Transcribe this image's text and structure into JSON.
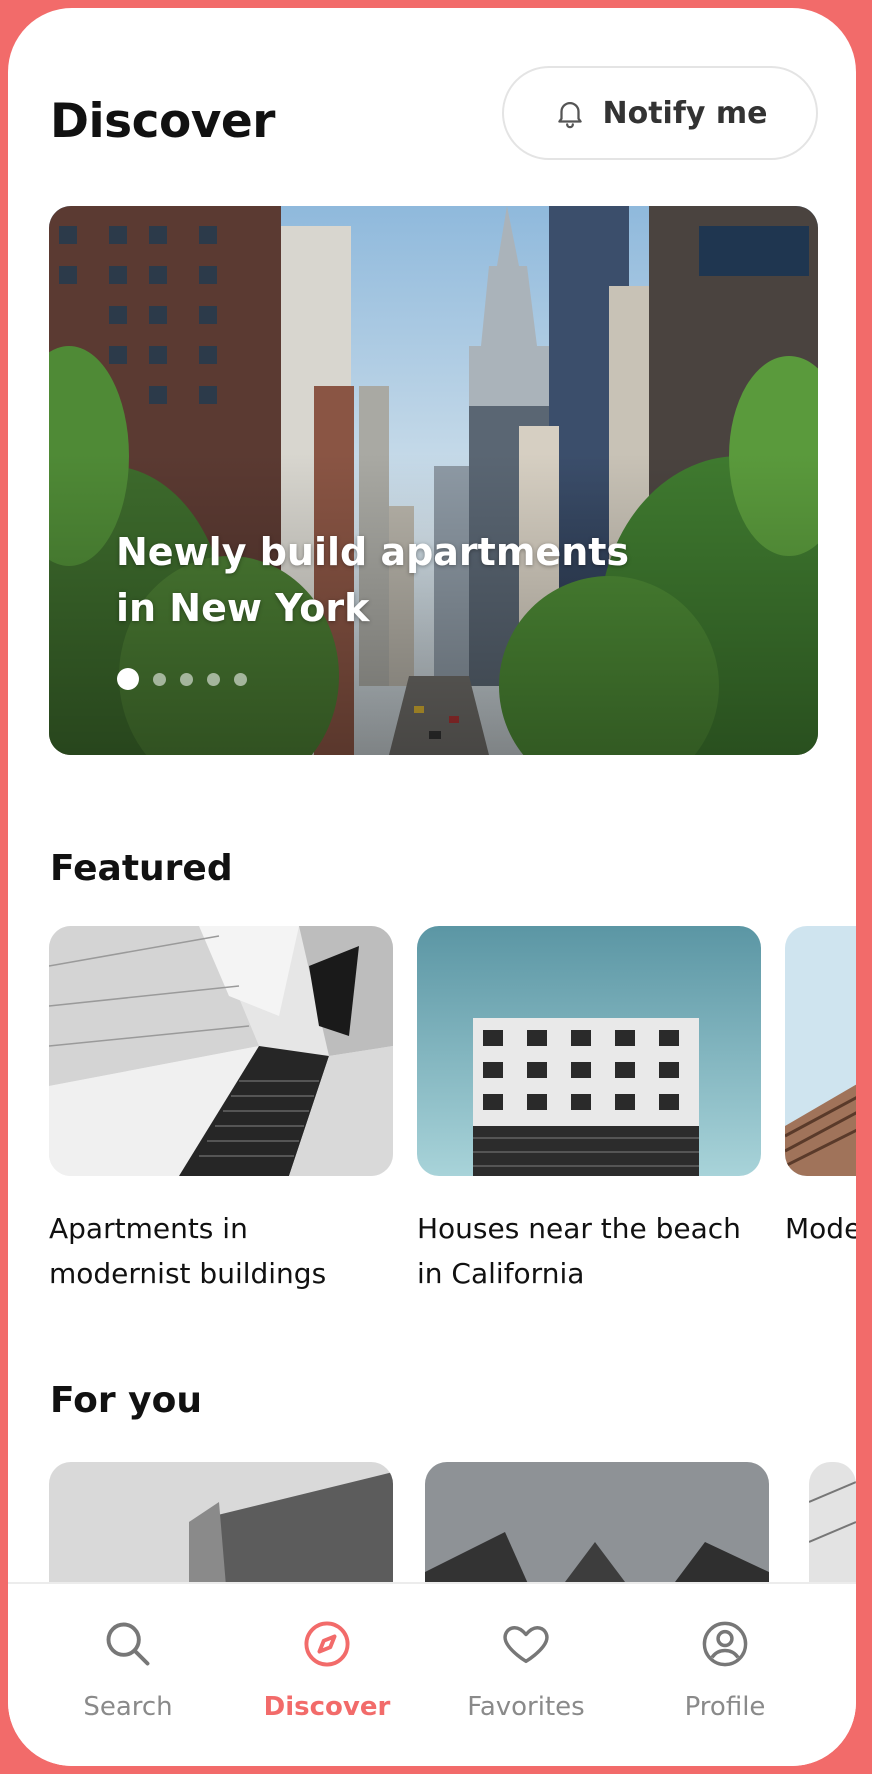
{
  "header": {
    "title": "Discover",
    "notify_label": "Notify me"
  },
  "hero": {
    "title_line1": "Newly build apartments",
    "title_line2": "in New York",
    "slides_total": 5,
    "active_slide": 1
  },
  "featured": {
    "title": "Featured",
    "cards": [
      {
        "line1": "Apartments in",
        "line2": "modernist buildings"
      },
      {
        "line1": "Houses near the beach",
        "line2": "in California"
      },
      {
        "line1": "Mode",
        "line2": ""
      }
    ]
  },
  "for_you": {
    "title": "For you"
  },
  "nav": {
    "items": [
      {
        "label": "Search",
        "icon": "search-icon"
      },
      {
        "label": "Discover",
        "icon": "compass-icon",
        "active": true
      },
      {
        "label": "Favorites",
        "icon": "heart-icon"
      },
      {
        "label": "Profile",
        "icon": "user-circle-icon"
      }
    ]
  },
  "colors": {
    "accent": "#f26b6a",
    "inactive": "#8a8a8a"
  }
}
